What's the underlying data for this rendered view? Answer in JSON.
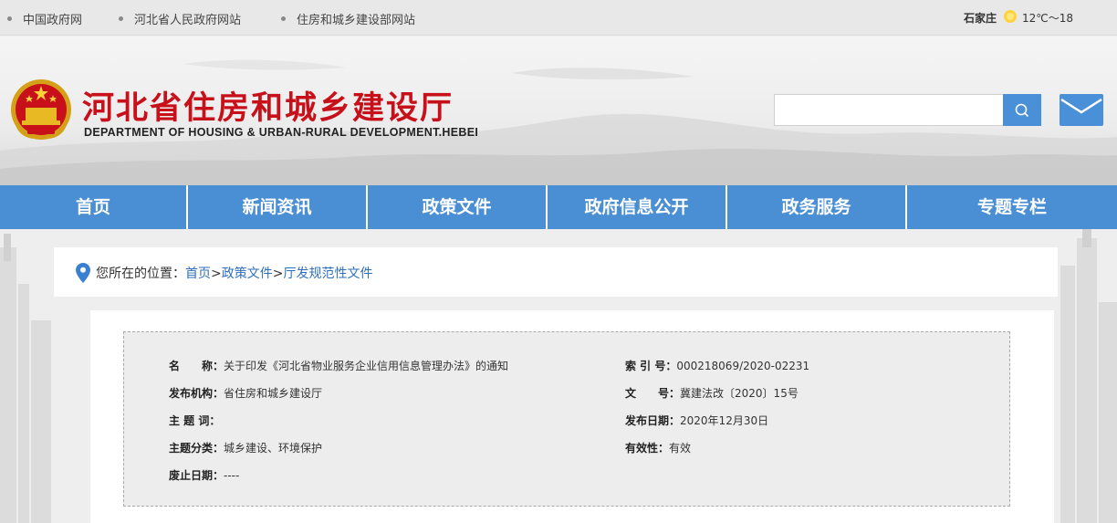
{
  "topbar": {
    "links": [
      "中国政府网",
      "河北省人民政府网站",
      "住房和城乡建设部网站"
    ],
    "weather": {
      "city": "石家庄",
      "temp": "12℃～18"
    }
  },
  "header": {
    "title": "河北省住房和城乡建设厅",
    "subtitle": "DEPARTMENT OF HOUSING & URBAN-RURAL DEVELOPMENT.HEBEI",
    "search_placeholder": ""
  },
  "nav": {
    "items": [
      "首页",
      "新闻资讯",
      "政策文件",
      "政府信息公开",
      "政务服务",
      "专题专栏"
    ]
  },
  "breadcrumb": {
    "prefix": "您所在的位置：",
    "home": "首页",
    "sep": ">",
    "level1": "政策文件",
    "level2": "厅发规范性文件"
  },
  "meta": {
    "name_label": "名　　称：",
    "name_value": "关于印发《河北省物业服务企业信用信息管理办法》的通知",
    "index_label": "索 引 号：",
    "index_value": "000218069/2020-02231",
    "org_label": "发布机构：",
    "org_value": "省住房和城乡建设厅",
    "docno_label": "文　　号：",
    "docno_value": "冀建法改〔2020〕15号",
    "keywords_label": "主 题 词：",
    "keywords_value": "",
    "date_label": "发布日期：",
    "date_value": "2020年12月30日",
    "category_label": "主题分类：",
    "category_value": "城乡建设、环境保护",
    "validity_label": "有效性：",
    "validity_value": "有效",
    "expire_label": "废止日期：",
    "expire_value": "----"
  },
  "colors": {
    "nav": "#4a8ed4",
    "title": "#c8101a",
    "link": "#2f6fbf"
  }
}
